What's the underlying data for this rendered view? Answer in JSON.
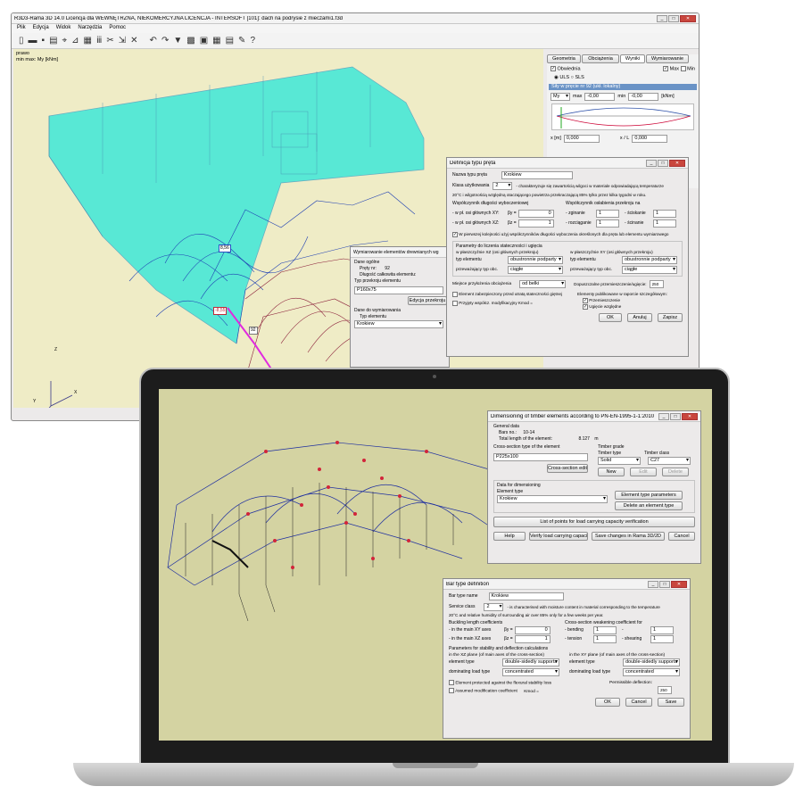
{
  "desktop": {
    "title": "R3D3-Rama 3D 14.0 Licencja dla WEWNĘTRZNA, NIEKOMERCYJNA LICENCJA - INTERSOFT [101]: dach na podrysie z mieczami1.f3d",
    "menu": [
      "Plik",
      "Edycja",
      "Widok",
      "Narzędzia",
      "Pomoc"
    ],
    "view_label": "prawo",
    "view_sublabel": "min max: My [kNm]",
    "axis_z": "Z",
    "axis_x": "X",
    "axis_y": "Y",
    "value_labels": [
      "8,56",
      "-8,55",
      "92"
    ],
    "panel": {
      "tabs": [
        "Geometria",
        "Obciążenia",
        "Wyniki",
        "Wymiarowanie"
      ],
      "obwiednia": "Obwiednia",
      "max": "Max",
      "min": "Min",
      "uls": "ULS",
      "sls": "SLS",
      "forces_title": "Siły w pręcie nr 92 (ukł. lokalny)",
      "component": "My",
      "max_label": "max",
      "max_value": "-0,00",
      "min_label": "min",
      "min_value": "-0,00",
      "unit": "[kNm]",
      "x_label": "x [m]",
      "x_value": "0,000",
      "xl_label": "x / L",
      "xl_value": "0,000"
    },
    "bar_def": {
      "title": "Definicja typu pręta",
      "name_label": "Nazwa typu pręta",
      "name_value": "Krokiew",
      "class_label": "Klasa użytkowania",
      "class_value": "2",
      "class_text": "- charakteryzuje się zawartością wilgoci w materiale odpowiadającą temperaturze",
      "class_text2": "20°C i wilgotnością względną otaczającego powietrza przekraczającą 85% tylko przez kilka tygodni w roku.",
      "buckling_title": "Współczynnik długości wyboczeniowej",
      "b_xy": "- w pł. osi głównych XY:",
      "b_xy_sym": "βy =",
      "b_xy_val": "0",
      "b_xz": "- w pł. osi głównych XZ:",
      "b_xz_sym": "βz =",
      "b_xz_val": "1",
      "weak_title": "Współczynnik osłabienia przekroju na",
      "w_bend": "- zginanie",
      "w_bend_val": "1",
      "w_comp": "- ściskanie",
      "w_comp_val": "1",
      "w_tens": "- rozciąganie",
      "w_tens_val": "1",
      "w_shear": "- ścinanie",
      "w_shear_val": "1",
      "first_check": "W pierwszej kolejności użyj współczynników długości wyboczenia określonych dla pręta lub elementu wymiarowego",
      "stab_title": "Parametry do liczenia stateczności i ugięcia",
      "xz_plane": "w płaszczyźnie XZ (osi głównych przekroju)",
      "xy_plane": "w płaszczyźnie XY (osi głównych przekroju)",
      "el_type": "typ elementu",
      "el_type_xz": "obustronnie podparty",
      "el_type_xy": "obustronnie podparty",
      "load_type": "przeważający typ obc.",
      "load_xz": "ciągłe",
      "load_xy": "ciągłe",
      "app_label": "Miejsce przyłożenia obciążenia",
      "app_value": "od belki",
      "perm_label": "Dopuszczalne przemieszczenie/ugięcie:",
      "perm_value": "250",
      "protected": "Element zabezpieczony przed utratą stateczności giętnej",
      "published": "Elementy publikowane w raporcie szczegółowym:",
      "pub1": "Przemieszczenie",
      "pub2": "Ugięcie względne",
      "mod": "Przyjęty współcz. modyfikacyjny",
      "kmod": "Kmod =",
      "ok": "OK",
      "cancel": "Anuluj",
      "save": "Zapisz"
    },
    "dim_dialog": {
      "title": "Wymiarowanie elementów drewnianych wg",
      "general": "Dane ogólne",
      "bars_label": "Pręty nr:",
      "bars_value": "92",
      "length_label": "Długość całkowita elementu:",
      "section_label": "Typ przekroju elementu",
      "section_value": "P160x75",
      "edit": "Edycja przekroju",
      "dim_data": "Dane do wymiarowania",
      "el_type": "Typ elementu",
      "el_value": "Krokiew"
    }
  },
  "laptop": {
    "dim": {
      "title": "Dimensioning of timber elements according to PN-EN-1995-1-1:2010",
      "general": "General data",
      "bars_label": "Bars no.:",
      "bars_value": "10-14",
      "length_label": "Total length of the element:",
      "length_value": "8.127",
      "length_unit": "m",
      "section_title": "Cross-section type of the element",
      "section_value": "P225x100",
      "section_edit": "Cross-section edit",
      "grade_title": "Timber grade",
      "type_label": "Timber type",
      "type_value": "Solid",
      "class_label": "Timber class",
      "class_value": "C27",
      "new": "New",
      "edit": "Edit",
      "delete": "Delete",
      "data_title": "Data for dimensioning",
      "el_type": "Element type",
      "el_value": "Krokiew",
      "el_params": "Element type parameters",
      "del_type": "Delete an element type",
      "list": "List of points for load carrying capacity verification",
      "help": "Help",
      "verify": "Verify load carrying capacity",
      "save": "Save changes in Rama 3D/2D",
      "cancel": "Cancel"
    },
    "bar": {
      "title": "Bar type definition",
      "name_label": "Bar type name",
      "name_value": "Krokiew",
      "class_label": "Service class",
      "class_value": "2",
      "class_text": "- is characterised with moisture content in material corresponding to the temperature",
      "class_text2": "20°C and relative humidity of surrounding air over 85% only for a few weeks per year.",
      "buck_title": "Buckling length coefficients",
      "b_xy": "- in the main XY axes",
      "b_xy_sym": "βy =",
      "b_xy_val": "0",
      "b_xz": "- in the main XZ axes",
      "b_xz_sym": "βz =",
      "b_xz_val": "1",
      "weak_title": "Cross-section weakening coefficient for",
      "w_bend": "- bending",
      "w_bend_val": "1",
      "w_dash": "-",
      "w_dash_val": "1",
      "w_tens": "- tension",
      "w_tens_val": "1",
      "w_shear": "- shearing",
      "w_shear_val": "1",
      "params_title": "Parameters for stability and deflection calculations",
      "xz": "in the XZ plane (of main axes of the cross-section)",
      "xy": "in the XY plane (of main axes of the cross-section)",
      "el_type": "element type",
      "el_xz": "double-sidedly supports",
      "el_xy": "double-sidedly supports",
      "load": "dominating load type",
      "load_xz": "concentrated",
      "load_xy": "concentrated",
      "protected": "Element protected against the flexural stability loss",
      "assumed": "Assumed modification coefficient",
      "kmod": "Kmod =",
      "perm": "Permissible deflection:",
      "perm_val": "250",
      "ok": "OK",
      "cancel": "Cancel",
      "save": "Save"
    }
  },
  "colors": {
    "viewport": "#efecc6",
    "cyan": "#3ee8d8",
    "laptop_bg": "#d4d3a2",
    "title_blue": "#6a93c6",
    "frame": "#1c1c1c"
  }
}
